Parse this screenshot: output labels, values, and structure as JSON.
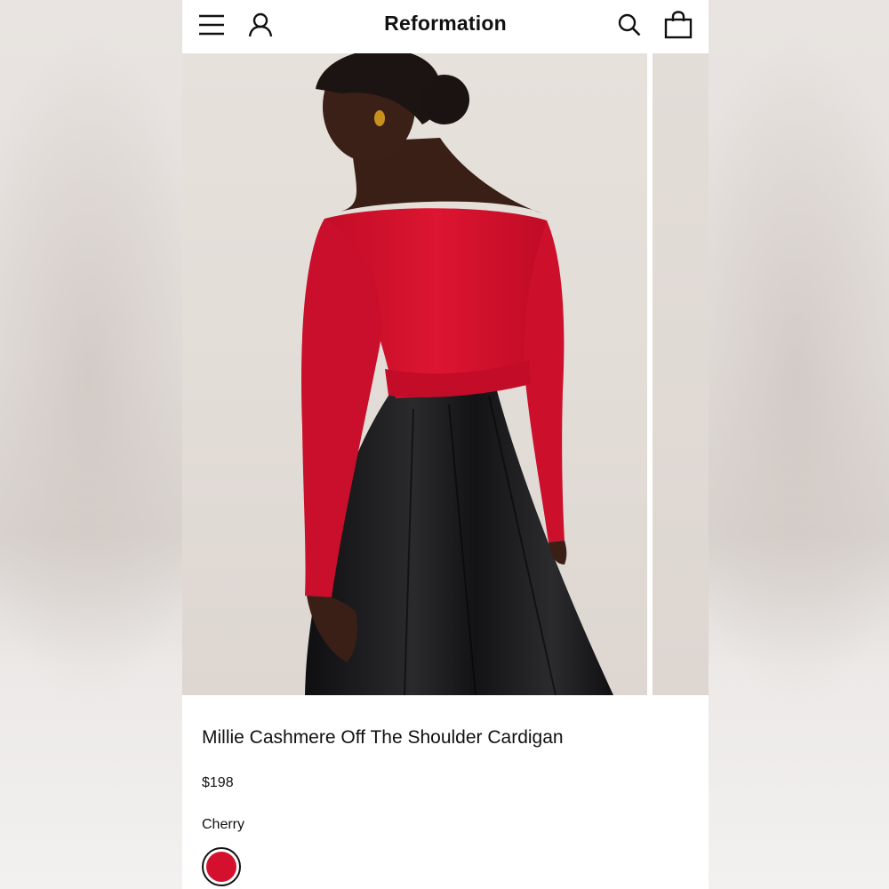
{
  "header": {
    "brand": "Reformation",
    "menu_icon": "hamburger-menu-icon",
    "account_icon": "user-icon",
    "search_icon": "search-icon",
    "bag_icon": "shopping-bag-icon"
  },
  "product": {
    "title": "Millie Cashmere Off The Shoulder Cardigan",
    "price": "$198",
    "color_name": "Cherry",
    "swatches": [
      {
        "name": "Cherry",
        "color": "#d5102f",
        "selected": true
      }
    ]
  },
  "colors": {
    "sweater": "#d4102e",
    "skirt": "#151517",
    "skin": "#3c2118",
    "photo_bg": "#e4ded9"
  }
}
